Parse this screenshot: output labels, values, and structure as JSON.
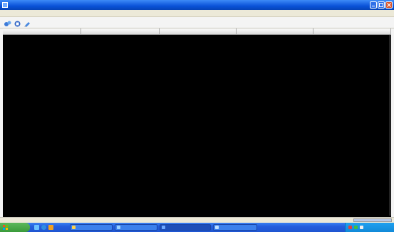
{
  "window": {
    "title": "",
    "menu": [
      ""
    ],
    "toolbar": [
      {
        "icon": "connect-icon"
      },
      {
        "icon": "stop-icon"
      },
      {
        "icon": "clear-icon"
      }
    ]
  },
  "table": {
    "columns": [
      {
        "key": "c1",
        "label": ""
      },
      {
        "key": "c2",
        "label": ""
      },
      {
        "key": "c3",
        "label": ""
      },
      {
        "key": "c4",
        "label": ""
      },
      {
        "key": "c5",
        "label": ""
      }
    ],
    "rows": [
      {
        "level": "error",
        "c1": "",
        "c2": "",
        "c3": "",
        "c4": "",
        "c5": ""
      },
      {
        "level": "ok",
        "c1": "",
        "c2": "",
        "c3": "",
        "c4": "",
        "c5": ""
      },
      {
        "level": "ok",
        "c1": "",
        "c2": "",
        "c3": "",
        "c4": "",
        "c5": ""
      },
      {
        "level": "error",
        "c1": "",
        "c2": "",
        "c3": "",
        "c4": "",
        "c5": ""
      },
      {
        "level": "ok",
        "c1": "",
        "c2": "",
        "c3": "",
        "c4": "",
        "c5": ""
      },
      {
        "level": "error",
        "c1": "",
        "c2": "",
        "c3": "",
        "c4": "",
        "c5": ""
      },
      {
        "level": "error",
        "c1": "",
        "c2": "",
        "c3": "",
        "c4": "",
        "c5": ""
      },
      {
        "level": "ok",
        "c1": "",
        "c2": "",
        "c3": "",
        "c4": "",
        "c5": ""
      },
      {
        "level": "error",
        "c1": "",
        "c2": "",
        "c3": "",
        "c4": "",
        "c5": ""
      },
      {
        "level": "error",
        "c1": "",
        "c2": "",
        "c3": "",
        "c4": "",
        "c5": ""
      },
      {
        "level": "ok",
        "c1": "",
        "c2": "",
        "c3": "",
        "c4": "",
        "c5": ""
      },
      {
        "level": "ok",
        "c1": "",
        "c2": "",
        "c3": "",
        "c4": "",
        "c5": ""
      },
      {
        "level": "error",
        "c1": "",
        "c2": "",
        "c3": "",
        "c4": "",
        "c5": ""
      },
      {
        "level": "ok",
        "c1": "",
        "c2": "",
        "c3": "",
        "c4": "",
        "c5": ""
      },
      {
        "level": "ok",
        "c1": "",
        "c2": "",
        "c3": "",
        "c4": "",
        "c5": ""
      },
      {
        "level": "error",
        "c1": "",
        "c2": "",
        "c3": "",
        "c4": "",
        "c5": ""
      },
      {
        "level": "ok",
        "c1": "",
        "c2": "",
        "c3": "",
        "c4": "",
        "c5": ""
      },
      {
        "level": "error",
        "c1": "",
        "c2": "",
        "c3": "",
        "c4": "",
        "c5": ""
      },
      {
        "level": "ok",
        "c1": "",
        "c2": "",
        "c3": "",
        "c4": "",
        "c5": ""
      },
      {
        "level": "error",
        "c1": "",
        "c2": "",
        "c3": "",
        "c4": "",
        "c5": ""
      },
      {
        "level": "ok",
        "c1": "",
        "c2": "",
        "c3": "",
        "c4": "",
        "c5": ""
      },
      {
        "level": "error",
        "c1": "",
        "c2": "",
        "c3": "",
        "c4": "",
        "c5": ""
      },
      {
        "level": "error",
        "c1": "",
        "c2": "",
        "c3": "",
        "c4": "",
        "c5": ""
      },
      {
        "level": "ok",
        "c1": "",
        "c2": "",
        "c3": "",
        "c4": "",
        "c5": ""
      },
      {
        "level": "error",
        "c1": "",
        "c2": "",
        "c3": "",
        "c4": "",
        "c5": ""
      },
      {
        "level": "ok",
        "c1": "",
        "c2": "",
        "c3": "",
        "c4": "",
        "c5": ""
      },
      {
        "level": "ok",
        "c1": "",
        "c2": "",
        "c3": "",
        "c4": "",
        "c5": ""
      },
      {
        "level": "error",
        "c1": "",
        "c2": "",
        "c3": "",
        "c4": "",
        "c5": ""
      },
      {
        "level": "error",
        "c1": "",
        "c2": "",
        "c3": "",
        "c4": "",
        "c5": ""
      },
      {
        "level": "ok",
        "c1": "",
        "c2": "",
        "c3": "",
        "c4": "",
        "c5": ""
      },
      {
        "level": "error",
        "c1": "",
        "c2": "",
        "c3": "",
        "c4": "",
        "c5": ""
      },
      {
        "level": "ok",
        "c1": "",
        "c2": "",
        "c3": "",
        "c4": "",
        "c5": ""
      },
      {
        "level": "error",
        "c1": "",
        "c2": "",
        "c3": "",
        "c4": "",
        "c5": ""
      },
      {
        "level": "ok",
        "c1": "",
        "c2": "",
        "c3": "",
        "c4": "",
        "c5": ""
      },
      {
        "level": "error",
        "c1": "",
        "c2": "",
        "c3": "",
        "c4": "",
        "c5": ""
      },
      {
        "level": "ok",
        "c1": "",
        "c2": "",
        "c3": "",
        "c4": "",
        "c5": ""
      },
      {
        "level": "error",
        "c1": "",
        "c2": "",
        "c3": "",
        "c4": "",
        "c5": ""
      },
      {
        "level": "ok",
        "c1": "",
        "c2": "",
        "c3": "",
        "c4": "",
        "c5": ""
      },
      {
        "level": "error",
        "c1": "",
        "c2": "",
        "c3": "",
        "c4": "",
        "c5": ""
      },
      {
        "level": "ok",
        "c1": "",
        "c2": "",
        "c3": "",
        "c4": "",
        "c5": ""
      },
      {
        "level": "error",
        "c1": "",
        "c2": "",
        "c3": "",
        "c4": "",
        "c5": ""
      },
      {
        "level": "ok",
        "c1": "",
        "c2": "",
        "c3": "",
        "c4": "",
        "c5": ""
      },
      {
        "level": "error",
        "c1": "",
        "c2": "",
        "c3": "",
        "c4": "",
        "c5": ""
      },
      {
        "level": "ok",
        "c1": "",
        "c2": "",
        "c3": "",
        "c4": "",
        "c5": ""
      },
      {
        "level": "error",
        "c1": "",
        "c2": "",
        "c3": "",
        "c4": "",
        "c5": ""
      },
      {
        "level": "ok",
        "c1": "",
        "c2": "",
        "c3": "",
        "c4": "",
        "c5": ""
      },
      {
        "level": "error",
        "c1": "",
        "c2": "",
        "c3": "",
        "c4": "",
        "c5": ""
      },
      {
        "level": "ok",
        "c1": "",
        "c2": "",
        "c3": "",
        "c4": "",
        "c5": ""
      },
      {
        "level": "error",
        "c1": "",
        "c2": "",
        "c3": "",
        "c4": "",
        "c5": ""
      },
      {
        "level": "ok",
        "c1": "",
        "c2": "",
        "c3": "",
        "c4": "",
        "c5": ""
      }
    ]
  },
  "statusbar": {
    "left": "",
    "right": ""
  },
  "taskbar": {
    "start_label": "",
    "tasks": [
      {
        "label": "",
        "active": false
      },
      {
        "label": "",
        "active": false
      },
      {
        "label": "",
        "active": true
      },
      {
        "label": "",
        "active": false
      }
    ],
    "clock": ""
  },
  "colors": {
    "ok_text": "#1fe01f",
    "error_text": "#ff2a2a",
    "table_bg": "#000000",
    "title_bar": "#0a52d8",
    "taskbar": "#245edc",
    "start_button": "#3a9a3a"
  }
}
